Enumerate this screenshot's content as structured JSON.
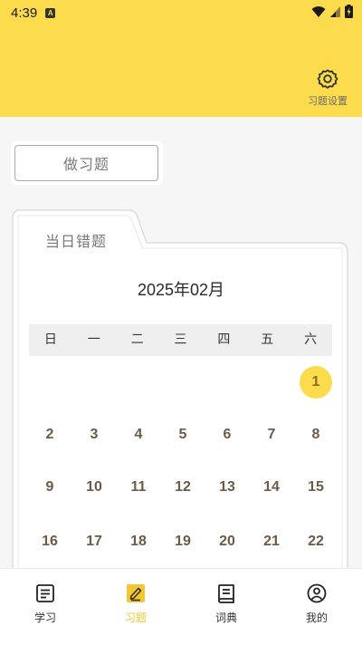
{
  "status_bar": {
    "time": "4:39",
    "app_icon_letter": "A"
  },
  "header": {
    "settings_label": "习题设置"
  },
  "practice": {
    "button_label": "做习题"
  },
  "mistakes": {
    "tab_label": "当日错题",
    "month_title": "2025年02月",
    "weekdays": [
      "日",
      "一",
      "二",
      "三",
      "四",
      "五",
      "六"
    ],
    "selected_day": "1",
    "days": [
      "1",
      "2",
      "3",
      "4",
      "5",
      "6",
      "7",
      "8",
      "9",
      "10",
      "11",
      "12",
      "13",
      "14",
      "15",
      "16",
      "17",
      "18",
      "19",
      "20",
      "21",
      "22"
    ]
  },
  "nav": [
    {
      "label": "学习",
      "icon": "study-icon",
      "active": false
    },
    {
      "label": "习题",
      "icon": "exercise-icon",
      "active": true
    },
    {
      "label": "词典",
      "icon": "dictionary-icon",
      "active": false
    },
    {
      "label": "我的",
      "icon": "profile-icon",
      "active": false
    }
  ],
  "colors": {
    "accent": "#fcdb4c",
    "active_nav": "#f2c832",
    "day_text": "#6e5a46"
  }
}
